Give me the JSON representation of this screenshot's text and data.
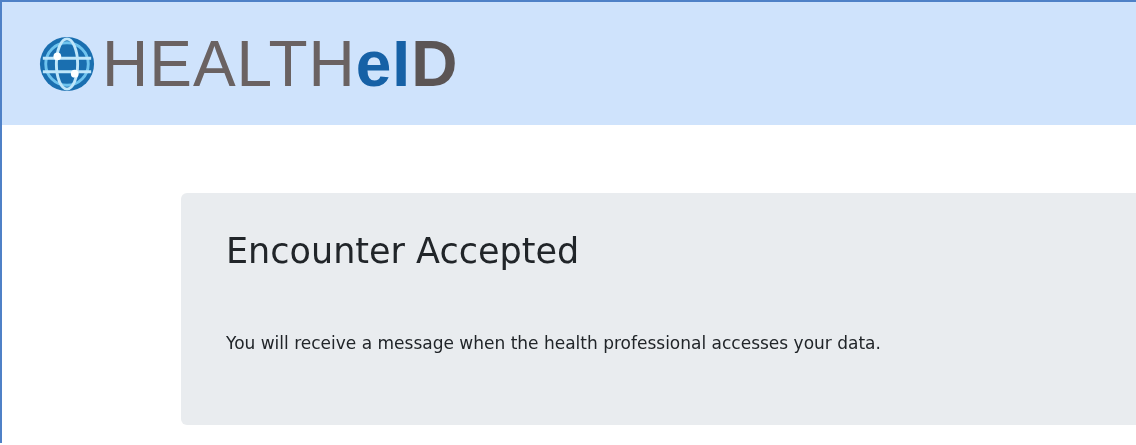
{
  "header": {
    "logo": [
      {
        "text": "HEALTH",
        "kind": "light"
      },
      {
        "text": "eI",
        "kind": "accent"
      },
      {
        "text": "D",
        "kind": "bold"
      }
    ]
  },
  "card": {
    "title": "Encounter Accepted",
    "message": "You will receive a message when the health professional accesses your data."
  }
}
